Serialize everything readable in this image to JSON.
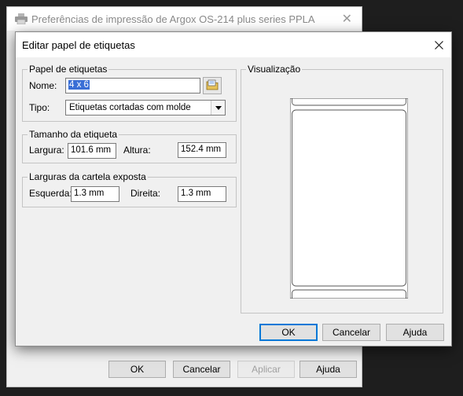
{
  "background_window": {
    "title": "Preferências de impressão de Argox OS-214 plus series PPLA",
    "buttons": {
      "ok": "OK",
      "cancel": "Cancelar",
      "apply": "Aplicar",
      "help": "Ajuda"
    }
  },
  "dialog": {
    "title": "Editar papel de etiquetas",
    "paper_group": {
      "legend": "Papel de etiquetas",
      "name_label": "Nome:",
      "name_value": "4 x 6",
      "type_label": "Tipo:",
      "type_value": "Etiquetas cortadas com molde"
    },
    "size_group": {
      "legend": "Tamanho da etiqueta",
      "width_label": "Largura:",
      "width_value": "101.6 mm",
      "height_label": "Altura:",
      "height_value": "152.4 mm"
    },
    "liner_group": {
      "legend": "Larguras da cartela exposta",
      "left_label": "Esquerda:",
      "left_value": "1.3 mm",
      "right_label": "Direita:",
      "right_value": "1.3 mm"
    },
    "preview_group": {
      "legend": "Visualização"
    },
    "buttons": {
      "ok": "OK",
      "cancel": "Cancelar",
      "help": "Ajuda"
    }
  },
  "icons": [
    "printer-icon",
    "close-icon",
    "browse-icon",
    "chevron-down-icon"
  ],
  "colors": {
    "selection": "#3a6fd6",
    "default_button_border": "#0078d7"
  }
}
